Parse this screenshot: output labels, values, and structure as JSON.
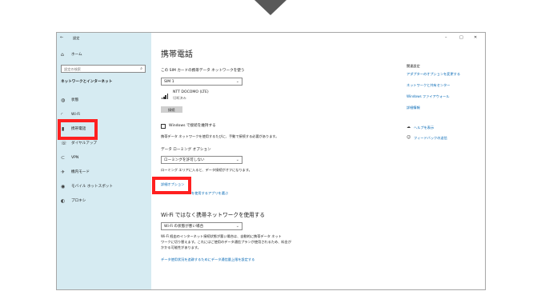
{
  "window": {
    "title": "設定",
    "back_glyph": "←",
    "controls": {
      "minimize": "–",
      "maximize": "□",
      "close": "✕"
    }
  },
  "sidebar": {
    "home_label": "ホーム",
    "search_placeholder": "設定の検索",
    "section_title": "ネットワークとインターネット",
    "items": [
      {
        "label": "状態",
        "icon": "globe-icon",
        "glyph": "◍"
      },
      {
        "label": "Wi-Fi",
        "icon": "wifi-icon",
        "glyph": "◜"
      },
      {
        "label": "携帯電話",
        "icon": "cellular-icon",
        "glyph": "▮"
      },
      {
        "label": "ダイヤルアップ",
        "icon": "dialup-icon",
        "glyph": "☏"
      },
      {
        "label": "VPN",
        "icon": "vpn-icon",
        "glyph": "⊂"
      },
      {
        "label": "機内モード",
        "icon": "airplane-icon",
        "glyph": "✈"
      },
      {
        "label": "モバイル ホットスポット",
        "icon": "hotspot-icon",
        "glyph": "◉"
      },
      {
        "label": "プロキシ",
        "icon": "proxy-icon",
        "glyph": "◐"
      }
    ]
  },
  "main": {
    "title": "携帯電話",
    "sim_question": "この SIM カードの携帯データ ネットワークを使う",
    "sim_selected": "SIM 1",
    "network_name": "NTT DOCOMO (LTE)",
    "network_status": "切断済み",
    "connect_button": "接続",
    "windows_managed_checkbox": "Windows で接続を維持する",
    "auto_connect_desc": "携帯データ ネットワークを使用するたびに、手動で接続する必要があります。",
    "roaming_label": "データ ローミング オプション",
    "roaming_selected": "ローミングを許可しない",
    "roaming_note": "ローミング エリアに入ると、データ接続がオフになります。",
    "advanced_options_link": "詳細オプション",
    "choose_apps_link": "を使用するアプリを選ぶ",
    "wifi_pref_heading": "Wi-Fi ではなく携帯ネットワークを使用する",
    "wifi_pref_selected": "Wi-Fi の状態が悪い場合",
    "wifi_pref_desc_1": "Wi-Fi 経由のインターネット接続状態が悪い場合は、自動的に携帯データ ネット",
    "wifi_pref_desc_2": "ワークに切り替えます。これにはご使用のデータ通信プランが使用されるため、料金が",
    "wifi_pref_desc_3": "かかる可能性があります。",
    "data_usage_link": "データ使用状況を追跡するためにデータ通信量上限を設定する"
  },
  "related": {
    "heading": "関連設定",
    "links": [
      "アダプターのオプションを変更する",
      "ネットワークと共有センター",
      "Windows ファイアウォール",
      "詳細情報"
    ],
    "help": {
      "label": "ヘルプを表示",
      "icon": "help-icon",
      "glyph": "☁"
    },
    "feedback": {
      "label": "フィードバックの送信",
      "icon": "feedback-icon",
      "glyph": "☺"
    }
  },
  "colors": {
    "sidebar_bg": "#d6ebf2",
    "highlight": "#ff2020",
    "link": "#0066b4",
    "arrow": "#595959"
  }
}
